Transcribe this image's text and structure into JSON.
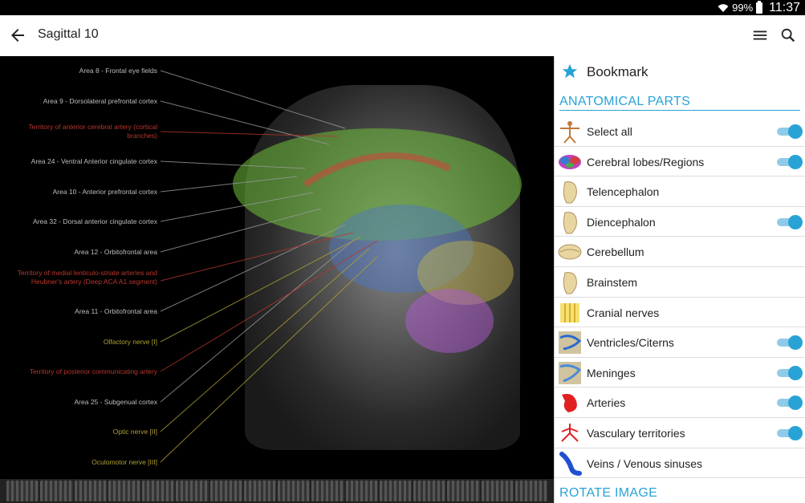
{
  "status": {
    "battery": "99%",
    "time": "11:37"
  },
  "header": {
    "title": "Sagittal 10"
  },
  "labels": [
    {
      "text": "Area 8 - Frontal eye fields",
      "color": "gray"
    },
    {
      "text": "Area 9 - Dorsolateral prefrontal cortex",
      "color": "gray"
    },
    {
      "text": "Territory of anterior cerebral artery (cortical branches)",
      "color": "red"
    },
    {
      "text": "Area 24 - Ventral Anterior cingulate cortex",
      "color": "gray"
    },
    {
      "text": "Area 10 - Anterior prefrontal cortex",
      "color": "gray"
    },
    {
      "text": "Area 32 - Dorsal anterior cingulate cortex",
      "color": "gray"
    },
    {
      "text": "Area 12 - Orbitofrontal area",
      "color": "gray"
    },
    {
      "text": "Territory of medial lenticulo-striate arteries and Heubner's artery (Deep ACA A1 segment)",
      "color": "red"
    },
    {
      "text": "Area 11 - Orbitofrontal area",
      "color": "gray"
    },
    {
      "text": "Olfactory nerve [I]",
      "color": "yellow"
    },
    {
      "text": "Territory of posterior communicating artery",
      "color": "red"
    },
    {
      "text": "Area 25 - Subgenual cortex",
      "color": "gray"
    },
    {
      "text": "Optic nerve [II]",
      "color": "yellow"
    },
    {
      "text": "Oculomotor nerve [III]",
      "color": "yellow"
    }
  ],
  "panel": {
    "bookmark": "Bookmark",
    "section_anatomical": "ANATOMICAL PARTS",
    "section_rotate": "ROTATE IMAGE",
    "items": [
      {
        "label": "Select all",
        "toggle": true,
        "icon": "body-icon"
      },
      {
        "label": "Cerebral lobes/Regions",
        "toggle": true,
        "icon": "brain-lobes-icon"
      },
      {
        "label": "Telencephalon",
        "toggle": false,
        "icon": "telencephalon-icon"
      },
      {
        "label": "Diencephalon",
        "toggle": true,
        "icon": "diencephalon-icon"
      },
      {
        "label": "Cerebellum",
        "toggle": false,
        "icon": "cerebellum-icon"
      },
      {
        "label": "Brainstem",
        "toggle": false,
        "icon": "brainstem-icon"
      },
      {
        "label": "Cranial nerves",
        "toggle": false,
        "icon": "cranial-nerves-icon"
      },
      {
        "label": "Ventricles/Citerns",
        "toggle": true,
        "icon": "ventricles-icon"
      },
      {
        "label": "Meninges",
        "toggle": true,
        "icon": "meninges-icon"
      },
      {
        "label": "Arteries",
        "toggle": true,
        "icon": "arteries-icon"
      },
      {
        "label": "Vasculary territories",
        "toggle": true,
        "icon": "vascular-territories-icon"
      },
      {
        "label": "Veins / Venous sinuses",
        "toggle": false,
        "icon": "veins-icon"
      }
    ]
  },
  "colors": {
    "accent": "#29a3d6",
    "toggle_track": "#8fcbe8",
    "label_red": "#b8362e",
    "label_yellow": "#b0a035"
  }
}
